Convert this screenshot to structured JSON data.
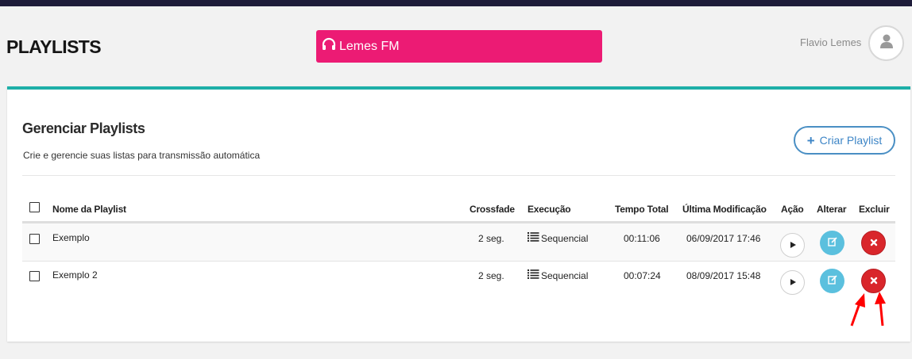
{
  "header": {
    "page_title": "PLAYLISTS",
    "radio_name": "Lemes FM",
    "user_name": "Flavio Lemes"
  },
  "panel": {
    "title": "Gerenciar Playlists",
    "description": "Crie e gerencie suas listas para transmissão automática",
    "create_button": "Criar Playlist"
  },
  "table": {
    "columns": [
      "Nome da Playlist",
      "Crossfade",
      "Execução",
      "Tempo Total",
      "Última Modificação",
      "Ação",
      "Alterar",
      "Excluir"
    ],
    "rows": [
      {
        "name": "Exemplo",
        "crossfade": "2 seg.",
        "execution": "Sequencial",
        "total_time": "00:11:06",
        "modified": "06/09/2017 17:46"
      },
      {
        "name": "Exemplo 2",
        "crossfade": "2 seg.",
        "execution": "Sequencial",
        "total_time": "00:07:24",
        "modified": "08/09/2017 15:48"
      }
    ]
  },
  "colors": {
    "banner": "#ec1b74",
    "accent_teal": "#1eafa8",
    "edit_button": "#5bc0de",
    "delete_button": "#d9262b",
    "create_button": "#3d85c6",
    "annotation_arrows": "#ff0000"
  },
  "icons": {
    "radio": "headphones-icon",
    "avatar": "user-icon",
    "create": "plus-icon",
    "execution": "list-icon",
    "action": "play-icon",
    "edit": "edit-icon",
    "delete": "times-icon"
  }
}
